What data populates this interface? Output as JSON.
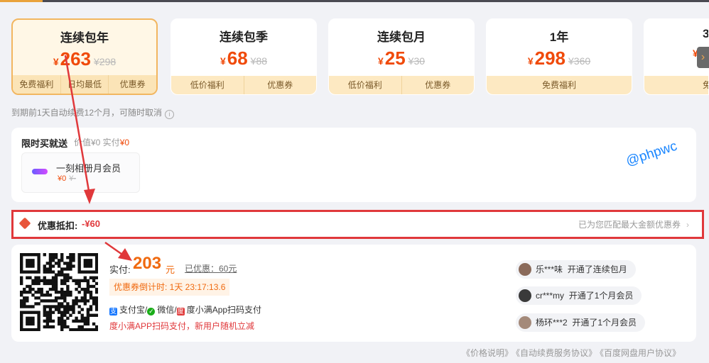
{
  "plans": [
    {
      "name": "连续包年",
      "yen": "¥",
      "price": "263",
      "old": "¥298",
      "tags": [
        "免费福利",
        "日均最低",
        "优惠券"
      ],
      "selected": true
    },
    {
      "name": "连续包季",
      "yen": "¥",
      "price": "68",
      "old": "¥88",
      "tags": [
        "低价福利",
        "优惠券"
      ],
      "selected": false
    },
    {
      "name": "连续包月",
      "yen": "¥",
      "price": "25",
      "old": "¥30",
      "tags": [
        "低价福利",
        "优惠券"
      ],
      "selected": false
    },
    {
      "name": "1年",
      "yen": "¥",
      "price": "298",
      "old": "¥360",
      "tags": [
        "免费福利"
      ],
      "selected": false
    },
    {
      "name": "3",
      "yen": "¥",
      "price": "",
      "old": "",
      "tags": [
        "免"
      ],
      "selected": false
    }
  ],
  "renew_note": "到期前1天自动续费12个月，可随时取消",
  "gift": {
    "title": "限时买就送",
    "value_prefix": "价值¥0 实付",
    "value_paid": "¥0",
    "item_name": "一刻相册月会员",
    "item_price": "¥0",
    "item_old": "¥-"
  },
  "watermark": "@phpwc",
  "discount": {
    "label": "优惠抵扣:",
    "amount": "-¥60",
    "hint": "已为您匹配最大金额优惠券"
  },
  "payment": {
    "paid_label": "实付:",
    "paid_amount": "203",
    "paid_unit": "元",
    "saved": "已优惠：60元",
    "countdown": "优惠券倒计时: 1天 23:17:13.6",
    "alipay": "支付宝/",
    "wechat": "微信/",
    "duxiaoman": "度小满App扫码支付",
    "promo": "度小满APP扫码支付，新用户随机立减"
  },
  "feed": [
    {
      "user": "乐***味",
      "action": "开通了连续包月"
    },
    {
      "user": "cr***my",
      "action": "开通了1个月会员"
    },
    {
      "user": "杨环***2",
      "action": "开通了1个月会员"
    }
  ],
  "footer": [
    "《价格说明》",
    "《自动续费服务协议》",
    "《百度网盘用户协议》"
  ],
  "colors": {
    "accent": "#f04a0a",
    "annotation": "#e0383b",
    "selected_border": "#f2b660"
  }
}
